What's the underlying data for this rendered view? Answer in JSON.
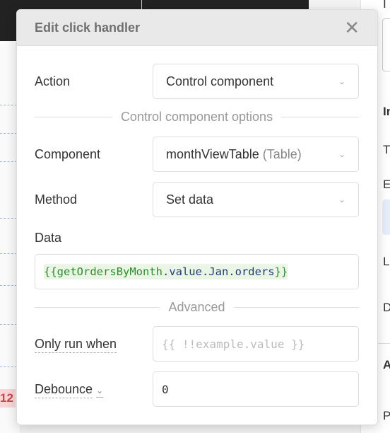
{
  "background": {
    "badge": "12",
    "right_panel_letters": [
      "I",
      "In",
      "T",
      "E",
      "L",
      "D",
      "A",
      "P"
    ]
  },
  "modal": {
    "title": "Edit click handler",
    "close_icon": "close-icon",
    "action": {
      "label": "Action",
      "value": "Control component"
    },
    "section_options": "Control component options",
    "component": {
      "label": "Component",
      "value": "monthViewTable",
      "type": "(Table)"
    },
    "method": {
      "label": "Method",
      "value": "Set data"
    },
    "data": {
      "label": "Data",
      "open": "{{",
      "ident": "getOrdersByMonth",
      "path": ".value.Jan.orders",
      "close": "}}"
    },
    "section_advanced": "Advanced",
    "only_run_when": {
      "label": "Only run when",
      "placeholder": "{{ !!example.value }}"
    },
    "debounce": {
      "label": "Debounce",
      "value": "0"
    }
  }
}
